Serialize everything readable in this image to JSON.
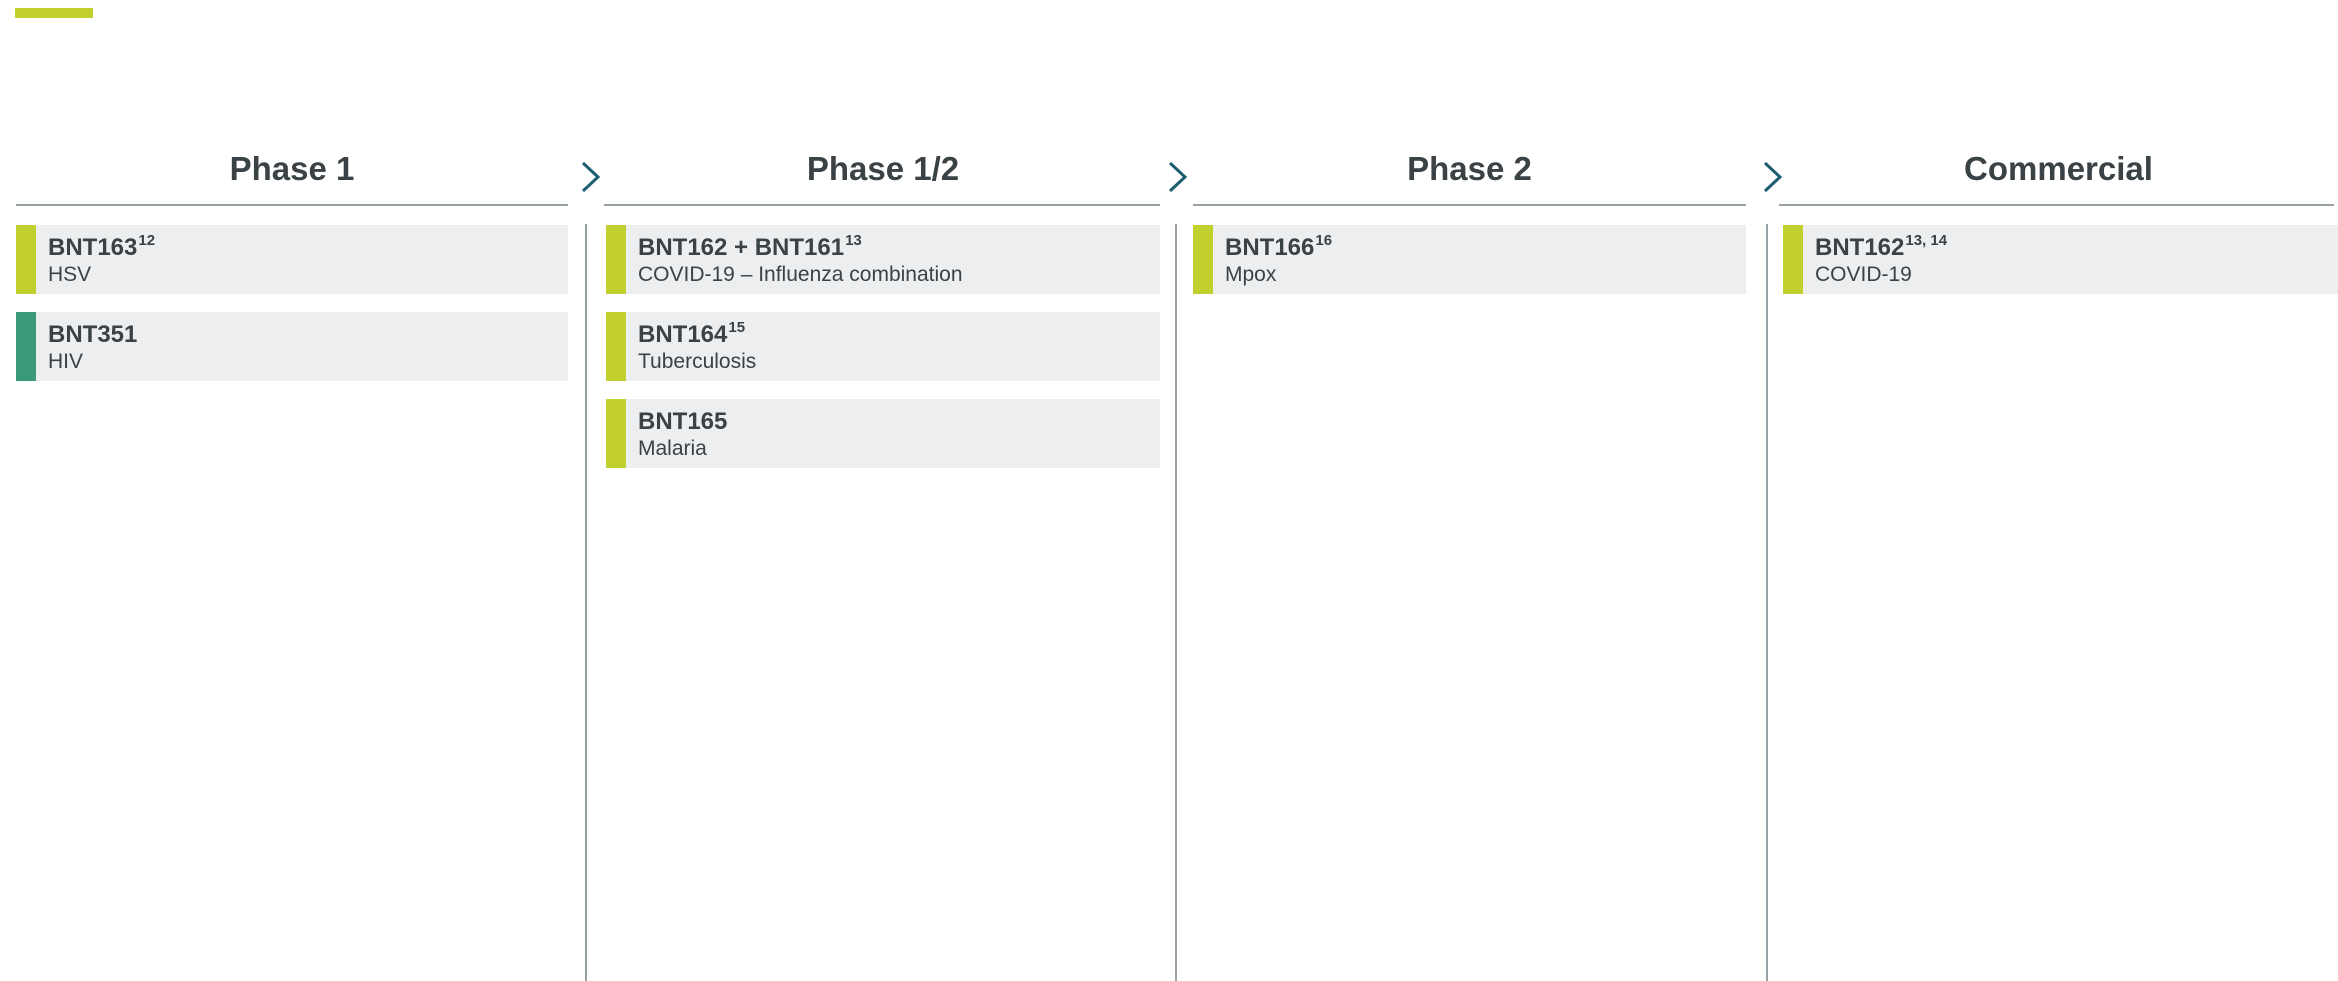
{
  "colors": {
    "accent": "#c2d02f",
    "marker_lime": "#c2d02f",
    "marker_teal": "#3a9a78",
    "card_bg": "#edeeef",
    "text": "#3a4246",
    "rule": "#97a1a6",
    "chevron": "#1d5d6f"
  },
  "columns": [
    {
      "title": "Phase 1",
      "cards": [
        {
          "name": "BNT163",
          "sup": "12",
          "indication": "HSV",
          "marker": "lime"
        },
        {
          "name": "BNT351",
          "sup": "",
          "indication": "HIV",
          "marker": "teal"
        }
      ]
    },
    {
      "title": "Phase 1/2",
      "cards": [
        {
          "name": "BNT162 + BNT161",
          "sup": "13",
          "indication": "COVID-19 – Influenza combination",
          "marker": "lime"
        },
        {
          "name": "BNT164",
          "sup": "15",
          "indication": "Tuberculosis",
          "marker": "lime"
        },
        {
          "name": "BNT165",
          "sup": "",
          "indication": "Malaria",
          "marker": "lime"
        }
      ]
    },
    {
      "title": "Phase 2",
      "cards": [
        {
          "name": "BNT166",
          "sup": "16",
          "indication": "Mpox",
          "marker": "lime"
        }
      ]
    },
    {
      "title": "Commercial",
      "cards": [
        {
          "name": "BNT162",
          "sup": "13, 14",
          "indication": "COVID-19",
          "marker": "lime"
        }
      ]
    }
  ],
  "icons": {
    "stage_arrow": "chevron-right-icon"
  }
}
